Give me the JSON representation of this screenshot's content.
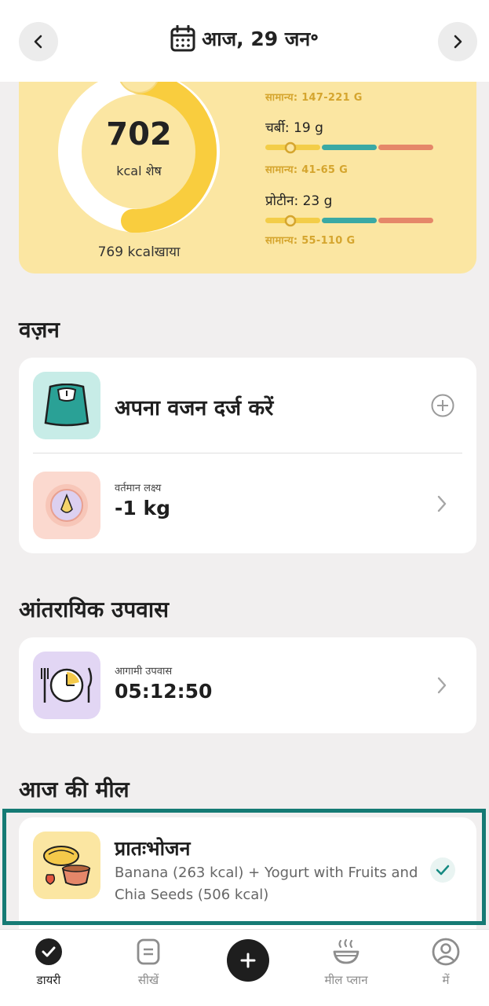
{
  "header": {
    "date_label": "आज, 29 जन॰"
  },
  "summary": {
    "kcal_remaining": "702",
    "kcal_remaining_label": "kcal शेष",
    "eaten_label": "769 kcalखाया",
    "carbs_normal": "सामान्य: 147-221 G",
    "fat_label": "चर्बी: 19 g",
    "fat_normal": "सामान्य: 41-65 G",
    "protein_label": "प्रोटीन: 23 g",
    "protein_normal": "सामान्य: 55-110 G",
    "colors": {
      "ring_bg": "#ffffff",
      "ring_fill": "#f9cd3e",
      "bar_low": "#f3cd48",
      "bar_mid": "#3aa9a4",
      "bar_high": "#e58769"
    }
  },
  "weight": {
    "title": "वज़न",
    "log_label": "अपना वजन दर्ज करें",
    "goal_small": "वर्तमान लक्ष्य",
    "goal_value": "-1 kg"
  },
  "fasting": {
    "title": "आंतरायिक उपवास",
    "upcoming_small": "आगामी उपवास",
    "timer": "05:12:50"
  },
  "meals": {
    "title": "आज की मील",
    "breakfast": {
      "name": "प्रातःभोजन",
      "description": "Banana (263 kcal) + Yogurt with Fruits and Chia Seeds (506 kcal)"
    }
  },
  "bottom_nav": {
    "diary": "डायरी",
    "learn": "सीखें",
    "meal_plan": "मील प्लान",
    "me": "में"
  }
}
